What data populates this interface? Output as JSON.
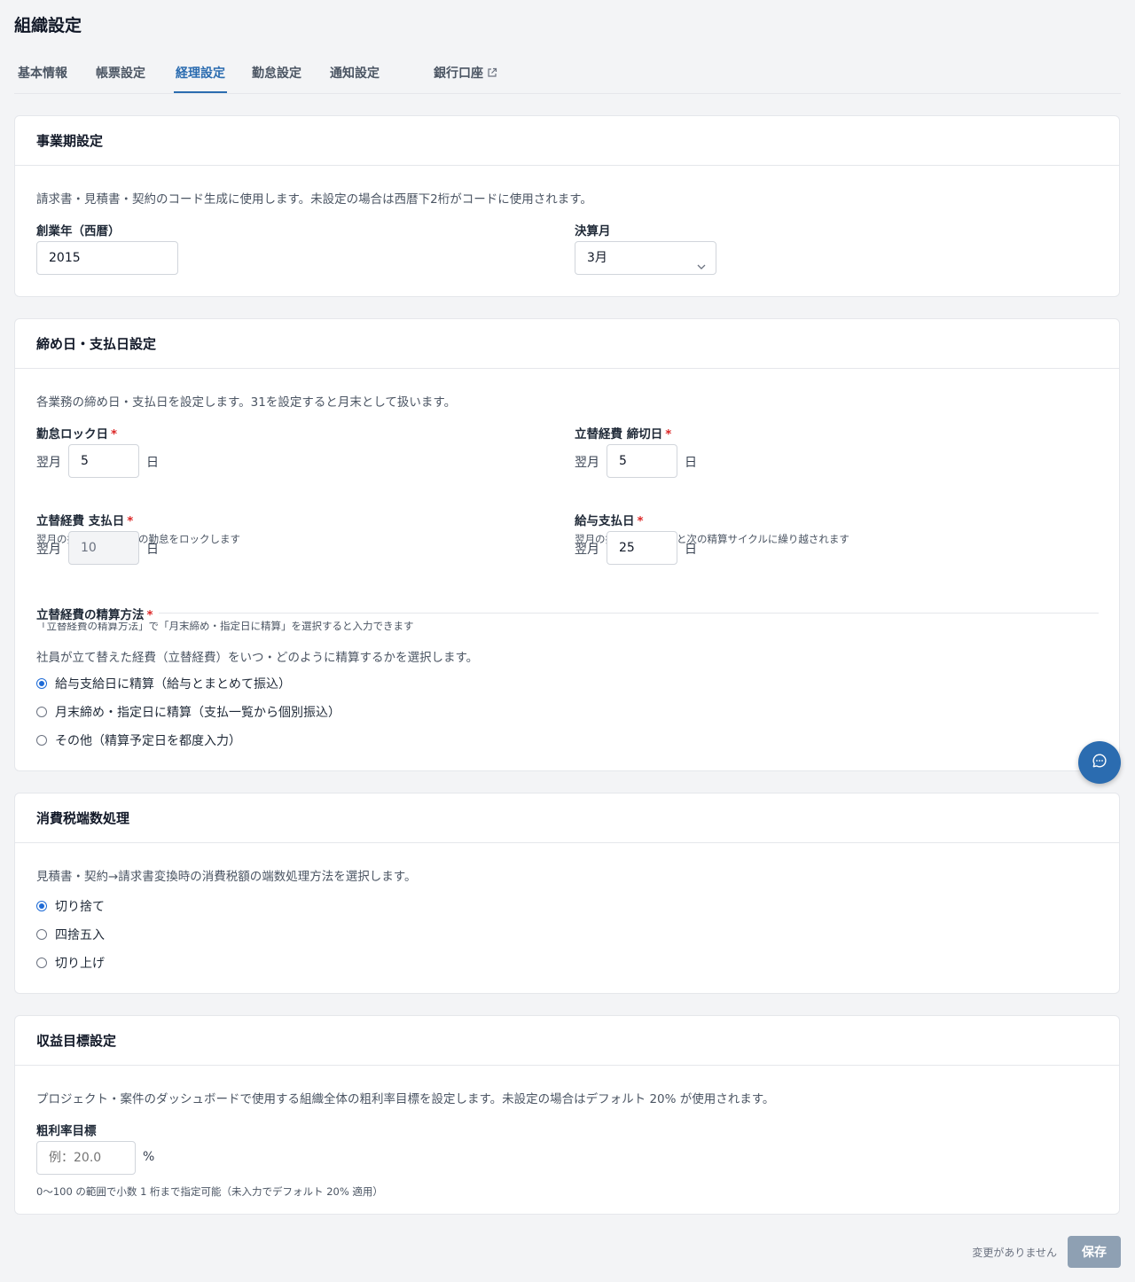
{
  "page": {
    "title": "組織設定"
  },
  "tabs": [
    {
      "label": "基本情報"
    },
    {
      "label": "帳票設定"
    },
    {
      "label": "経理設定"
    },
    {
      "label": "勤怠設定"
    },
    {
      "label": "通知設定"
    },
    {
      "label": "銀行口座"
    }
  ],
  "active_tab": "経理設定",
  "fiscal": {
    "title": "事業期設定",
    "description": "請求書・見積書・契約のコード生成に使用します。未設定の場合は西暦下2桁がコードに使用されます。",
    "founded_label": "創業年（西暦）",
    "founded_value": "2015",
    "closing_month_label": "決算月",
    "closing_month_value": "3月"
  },
  "cutoff": {
    "title": "締め日・支払日設定",
    "description": "各業務の締め日・支払日を設定します。31を設定すると月末として扱います。",
    "attendance_lock": {
      "label": "勤怠ロック日",
      "prefix": "翌月",
      "value": "5",
      "suffix": "日",
      "hint": "翌月の指定日に前月分の勤怠をロックします"
    },
    "expense_cutoff": {
      "label": "立替経費 締切日",
      "prefix": "翌月",
      "value": "5",
      "suffix": "日",
      "hint": "翌月の指定日を過ぎると次の精算サイクルに繰り越されます"
    },
    "expense_payment": {
      "label": "立替経費 支払日",
      "prefix": "翌月",
      "value": "10",
      "suffix": "日",
      "hint": "「立替経費の精算方法」で「月末締め・指定日に精算」を選択すると入力できます",
      "disabled": true
    },
    "salary_payment": {
      "label": "給与支払日",
      "prefix": "翌月",
      "value": "25",
      "suffix": "日"
    },
    "required_mark": "*",
    "method": {
      "label": "立替経費の精算方法",
      "description": "社員が立て替えた経費（立替経費）をいつ・どのように精算するかを選択します。",
      "options": [
        {
          "label": "給与支給日に精算（給与とまとめて振込）",
          "checked": true
        },
        {
          "label": "月末締め・指定日に精算（支払一覧から個別振込）",
          "checked": false
        },
        {
          "label": "その他（精算予定日を都度入力）",
          "checked": false
        }
      ]
    }
  },
  "tax": {
    "title": "消費税端数処理",
    "description": "見積書・契約→請求書変換時の消費税額の端数処理方法を選択します。",
    "options": [
      {
        "label": "切り捨て",
        "checked": true
      },
      {
        "label": "四捨五入",
        "checked": false
      },
      {
        "label": "切り上げ",
        "checked": false
      }
    ]
  },
  "profit": {
    "title": "収益目標設定",
    "description": "プロジェクト・案件のダッシュボードで使用する組織全体の粗利率目標を設定します。未設定の場合はデフォルト 20% が使用されます。",
    "target_label": "粗利率目標",
    "target_placeholder": "例：20.0",
    "target_value": "",
    "unit": "%",
    "hint": "0〜100 の範囲で小数 1 桁まで指定可能（未入力でデフォルト 20% 適用）"
  },
  "footer": {
    "status": "変更がありません",
    "save_label": "保存"
  },
  "colors": {
    "accent": "#2b6cb0",
    "radio_checked": "#1e6bd6",
    "required": "#dc2626",
    "save_disabled": "#8ea0b3",
    "background": "#f3f4f6"
  },
  "icons": {
    "external_link": "external-link-icon",
    "select_chevron": "chevron-down-icon",
    "chat": "chat-bubble-icon"
  }
}
